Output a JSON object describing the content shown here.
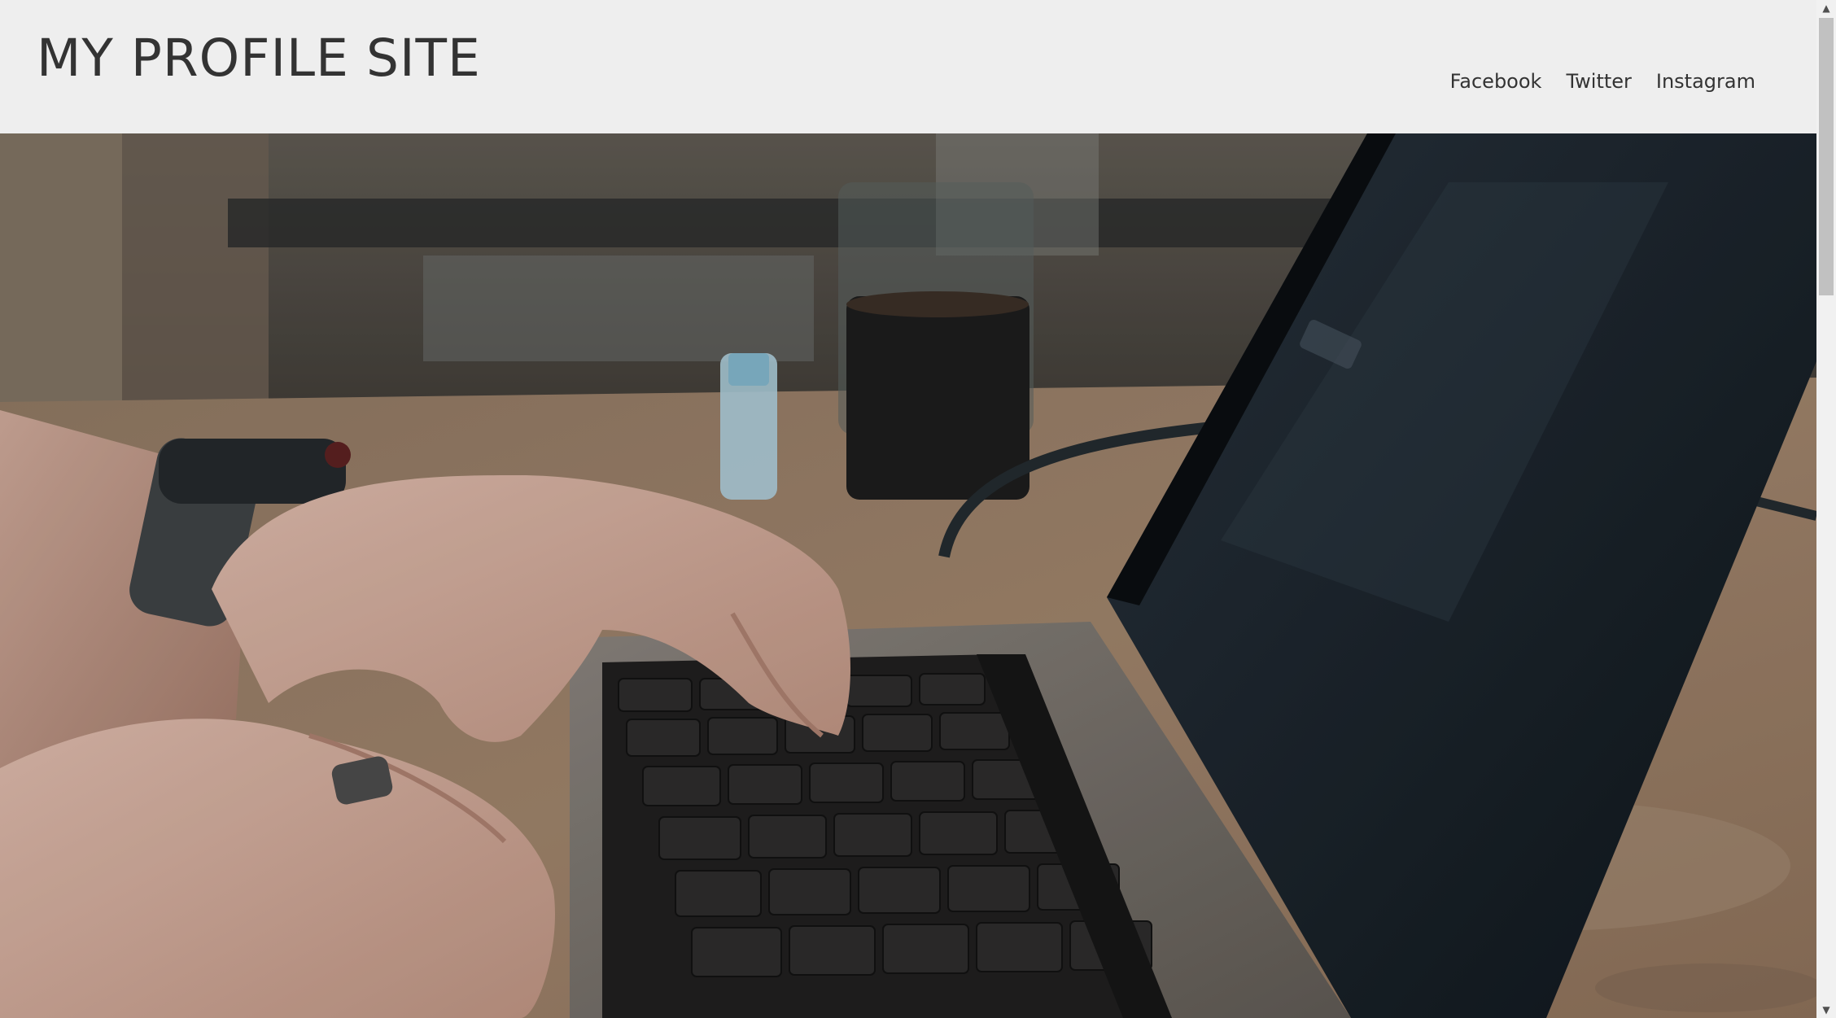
{
  "site": {
    "title": "MY PROFILE SITE"
  },
  "nav": {
    "items": [
      {
        "label": "Facebook"
      },
      {
        "label": "Twitter"
      },
      {
        "label": "Instagram"
      }
    ]
  },
  "hero": {
    "image": "laptop-typing-photo"
  },
  "scrollbar": {
    "up_icon": "triangle-up",
    "down_icon": "triangle-down"
  },
  "colors": {
    "header_bg": "#eeeeee",
    "text": "#333333"
  }
}
